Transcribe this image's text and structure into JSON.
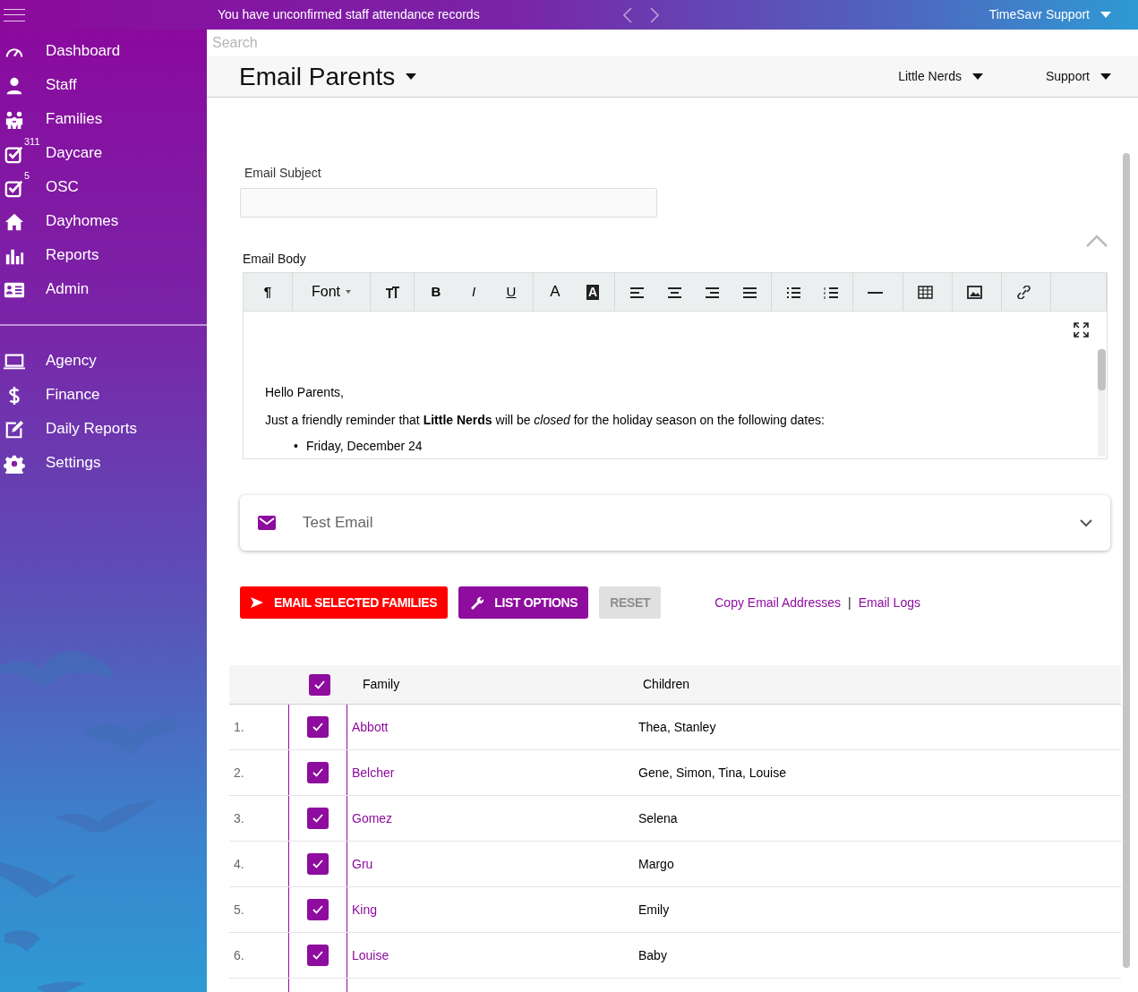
{
  "top_bar": {
    "notice": "You have unconfirmed staff attendance records",
    "account": "TimeSavr Support"
  },
  "sidebar": {
    "groups": [
      [
        {
          "label": "Dashboard"
        },
        {
          "label": "Staff"
        },
        {
          "label": "Families"
        },
        {
          "label": "Daycare",
          "badge": "311"
        },
        {
          "label": "OSC",
          "badge": "5"
        },
        {
          "label": "Dayhomes"
        },
        {
          "label": "Reports"
        },
        {
          "label": "Admin"
        }
      ],
      [
        {
          "label": "Agency"
        },
        {
          "label": "Finance"
        },
        {
          "label": "Daily Reports"
        },
        {
          "label": "Settings"
        }
      ]
    ]
  },
  "search": {
    "placeholder": "Search"
  },
  "header": {
    "title": "Email Parents",
    "menus": [
      "Little Nerds",
      "Support"
    ]
  },
  "subject": {
    "label": "Email Subject"
  },
  "body": {
    "label": "Email Body",
    "toolbar": {
      "paragraph": "¶",
      "font": "Font",
      "bold": "B",
      "italic": "I",
      "underline": "U",
      "font_color": "A",
      "highlight": "A"
    },
    "greeting": "Hello Parents,",
    "paragraph": "Just a friendly reminder that **Little Nerds** will be *closed* for the holiday season on the following dates:",
    "marker": "•",
    "dates": [
      "Friday, December 24"
    ]
  },
  "test_email": {
    "label": "Test Email",
    "expanded": false
  },
  "actions": {
    "buttons": [
      {
        "label": "EMAIL SELECTED FAMILIES",
        "kind": "send",
        "disabled": false
      },
      {
        "label": "LIST OPTIONS",
        "kind": "options",
        "disabled": false
      },
      {
        "label": "RESET",
        "kind": "reset",
        "disabled": true
      }
    ],
    "links": [
      "Copy Email Addresses",
      "Email Logs"
    ],
    "separator": "|"
  },
  "table": {
    "all_checked": true,
    "columns": [
      "Family",
      "Children"
    ],
    "rows": [
      {
        "index": "1.",
        "checked": true,
        "family": "Abbott",
        "children": "Thea, Stanley"
      },
      {
        "index": "2.",
        "checked": true,
        "family": "Belcher",
        "children": "Gene, Simon, Tina, Louise"
      },
      {
        "index": "3.",
        "checked": true,
        "family": "Gomez",
        "children": "Selena"
      },
      {
        "index": "4.",
        "checked": true,
        "family": "Gru",
        "children": "Margo"
      },
      {
        "index": "5.",
        "checked": true,
        "family": "King",
        "children": "Emily"
      },
      {
        "index": "6.",
        "checked": true,
        "family": "Louise",
        "children": "Baby"
      }
    ]
  }
}
